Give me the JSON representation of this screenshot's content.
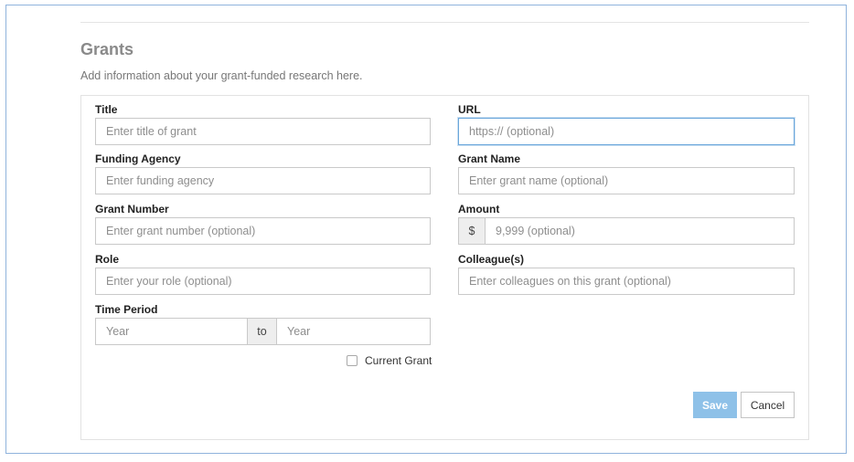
{
  "section": {
    "title": "Grants",
    "description": "Add information about your grant-funded research here."
  },
  "form": {
    "title": {
      "label": "Title",
      "placeholder": "Enter title of grant",
      "value": ""
    },
    "url": {
      "label": "URL",
      "placeholder": "https:// (optional)",
      "value": ""
    },
    "funding_agency": {
      "label": "Funding Agency",
      "placeholder": "Enter funding agency",
      "value": ""
    },
    "grant_name": {
      "label": "Grant Name",
      "placeholder": "Enter grant name (optional)",
      "value": ""
    },
    "grant_number": {
      "label": "Grant Number",
      "placeholder": "Enter grant number (optional)",
      "value": ""
    },
    "amount": {
      "label": "Amount",
      "currency_symbol": "$",
      "placeholder": "9,999 (optional)",
      "value": ""
    },
    "role": {
      "label": "Role",
      "placeholder": "Enter your role (optional)",
      "value": ""
    },
    "colleagues": {
      "label": "Colleague(s)",
      "placeholder": "Enter colleagues on this grant (optional)",
      "value": ""
    },
    "time_period": {
      "label": "Time Period",
      "start_placeholder": "Year",
      "separator": "to",
      "end_placeholder": "Year"
    },
    "current_grant": {
      "label": "Current Grant",
      "checked": false
    }
  },
  "actions": {
    "save_label": "Save",
    "cancel_label": "Cancel"
  },
  "colors": {
    "frame_border": "#8fb3dc",
    "focus_border": "#6aa6db",
    "save_button": "#8ec1e8"
  }
}
